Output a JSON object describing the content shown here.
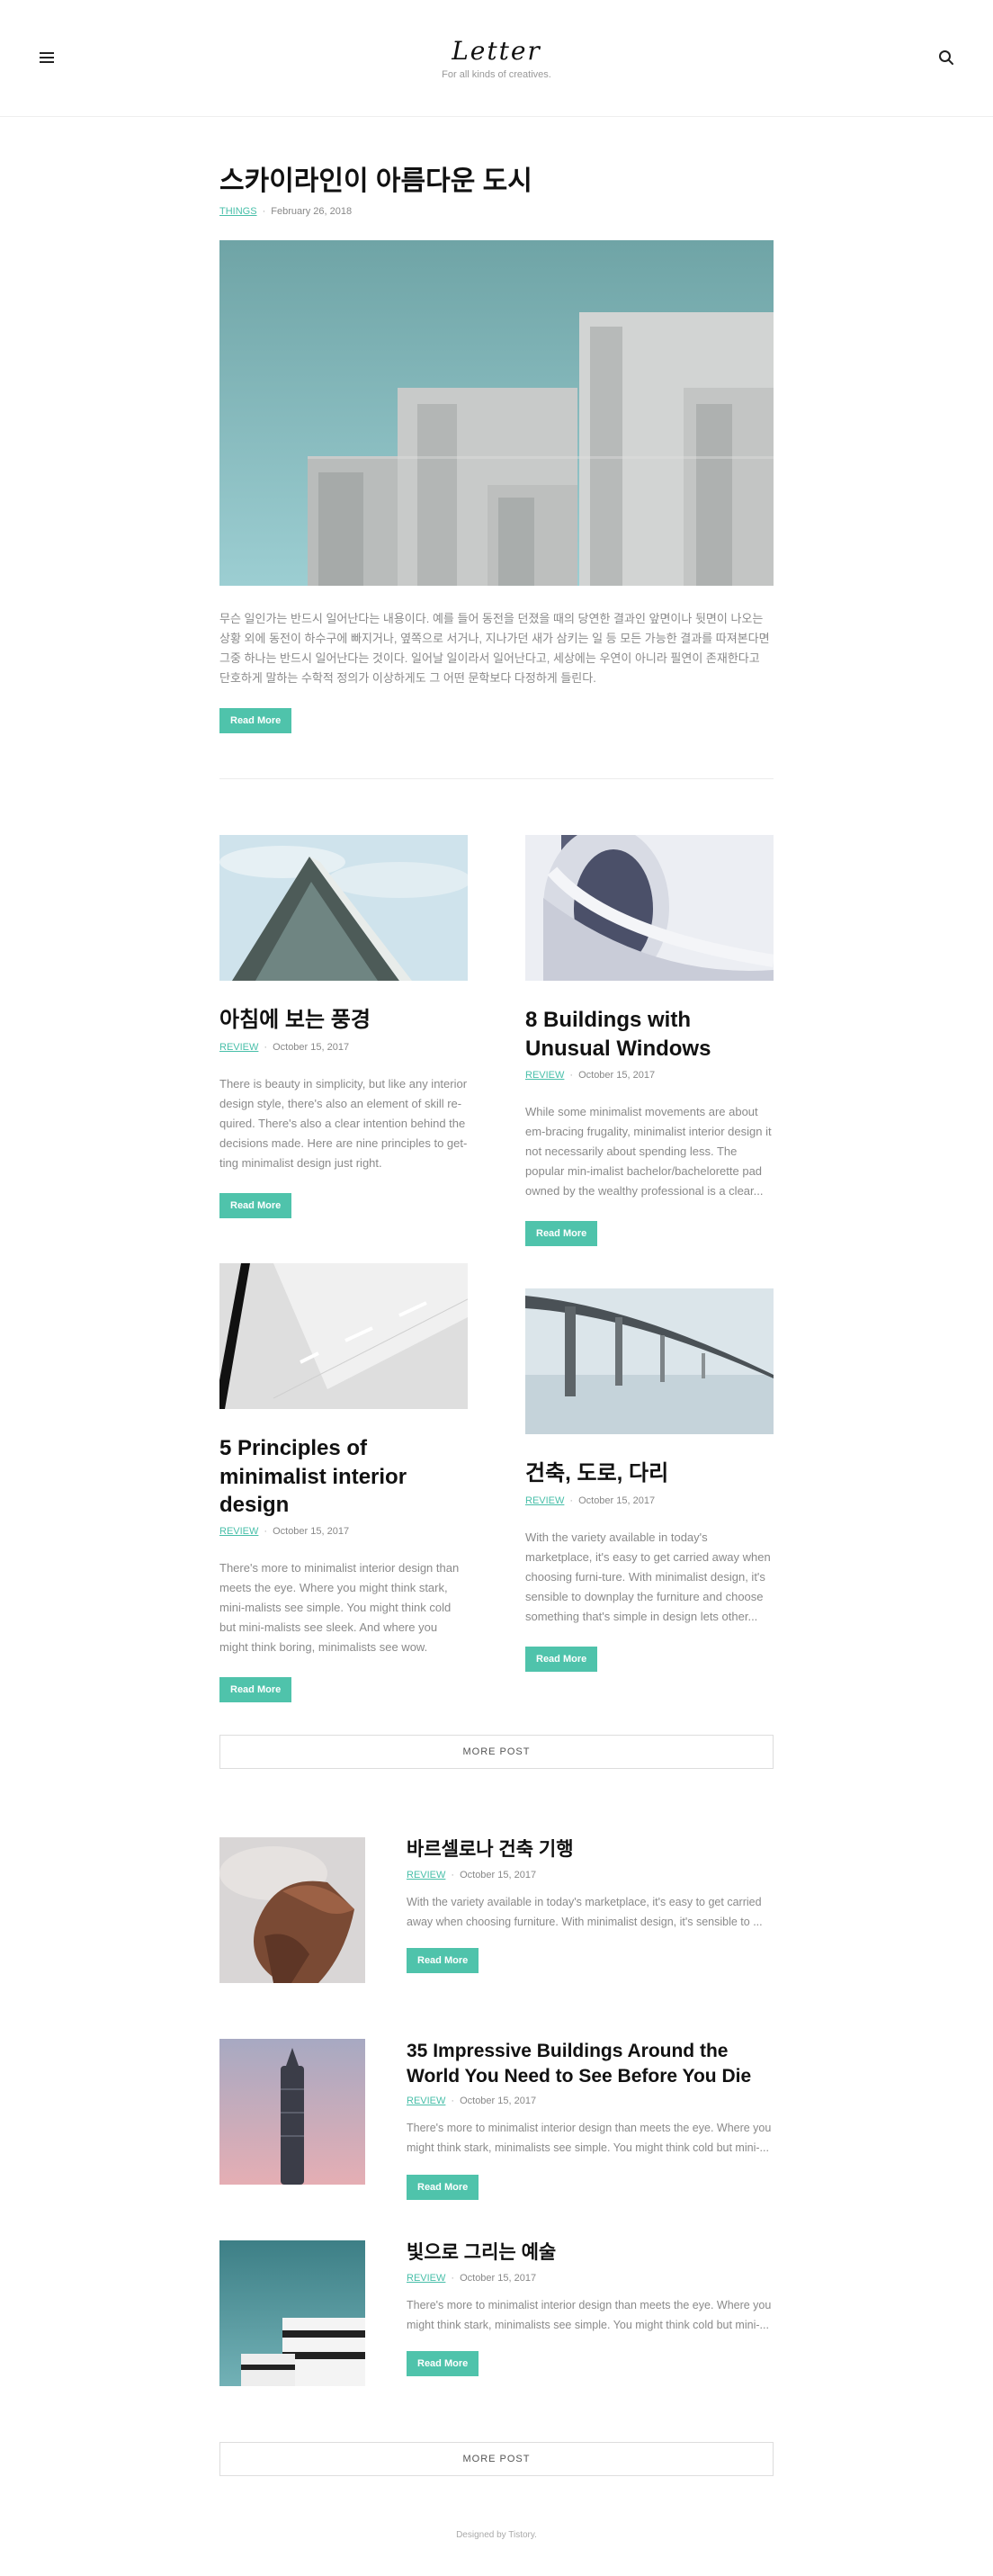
{
  "header": {
    "brand": "Letter",
    "tagline": "For all kinds of creatives."
  },
  "featured": {
    "title": "스카이라인이 아름다운 도시",
    "category": "THINGS",
    "date": "February 26, 2018",
    "excerpt": "무슨 일인가는 반드시 일어난다는 내용이다. 예를 들어 동전을 던졌을 때의 당연한 결과인 앞면이나 뒷면이 나오는 상황 외에 동전이 하수구에 빠지거나, 옆쪽으로 서거나, 지나가던 새가 삼키는 일 등 모든 가능한 결과를 따져본다면 그중 하나는 반드시 일어난다는 것이다. 일어날 일이라서 일어난다고, 세상에는 우연이 아니라 필연이 존재한다고 단호하게 말하는 수학적 정의가 이상하게도 그 어떤 문학보다 다정하게 들린다.",
    "button": "Read More"
  },
  "grid": [
    {
      "title": "아침에 보는 풍경",
      "category": "REVIEW",
      "date": "October 15, 2017",
      "excerpt": "There is beauty in simplicity, but like any interior design style, there's also an element of skill re-quired. There's also a clear intention behind the decisions made. Here are nine principles to get-ting minimalist design just right.",
      "button": "Read More"
    },
    {
      "title": "8 Buildings with Unusual Windows",
      "category": "REVIEW",
      "date": "October 15, 2017",
      "excerpt": "While some minimalist movements are about em-bracing frugality, minimalist interior design it not necessarily about spending less. The popular min-imalist bachelor/bachelorette pad owned by the wealthy professional is a clear...",
      "button": "Read More"
    },
    {
      "title": "5 Principles of minimalist interior design",
      "category": "REVIEW",
      "date": "October 15, 2017",
      "excerpt": "There's more to minimalist interior design than meets the eye. Where you might think stark, mini-malists see simple. You might think cold but mini-malists see sleek. And where you might think boring, minimalists see wow.",
      "button": "Read More"
    },
    {
      "title": "건축, 도로, 다리",
      "category": "REVIEW",
      "date": "October 15, 2017",
      "excerpt": "With the variety available in today's marketplace, it's easy to get carried away when choosing furni-ture. With minimalist design, it's sensible to downplay the furniture and choose something that's simple in design lets other...",
      "button": "Read More"
    }
  ],
  "more_post_1": "MORE POST",
  "list": [
    {
      "title": "바르셀로나 건축 기행",
      "category": "REVIEW",
      "date": "October 15, 2017",
      "excerpt": "With the variety available in today's marketplace, it's easy to get carried away when choosing furniture. With minimalist design, it's sensible to ...",
      "button": "Read More"
    },
    {
      "title": "35 Impressive Buildings Around the World You Need to See Before You Die",
      "category": "REVIEW",
      "date": "October 15, 2017",
      "excerpt": "There's more to minimalist interior design than meets the eye. Where you might think stark, minimalists see simple. You might think cold but mini-...",
      "button": "Read More"
    },
    {
      "title": "빛으로 그리는 예술",
      "category": "REVIEW",
      "date": "October 15, 2017",
      "excerpt": "There's more to minimalist interior design than meets the eye. Where you might think stark, minimalists see simple. You might think cold but mini-...",
      "button": "Read More"
    }
  ],
  "more_post_2": "MORE POST",
  "footer": "Designed by Tistory.",
  "colors": {
    "accent": "#4fc3ab",
    "link": "#48bfa9"
  },
  "icons": {
    "menu": "hamburger-menu-icon",
    "search": "search-icon"
  }
}
